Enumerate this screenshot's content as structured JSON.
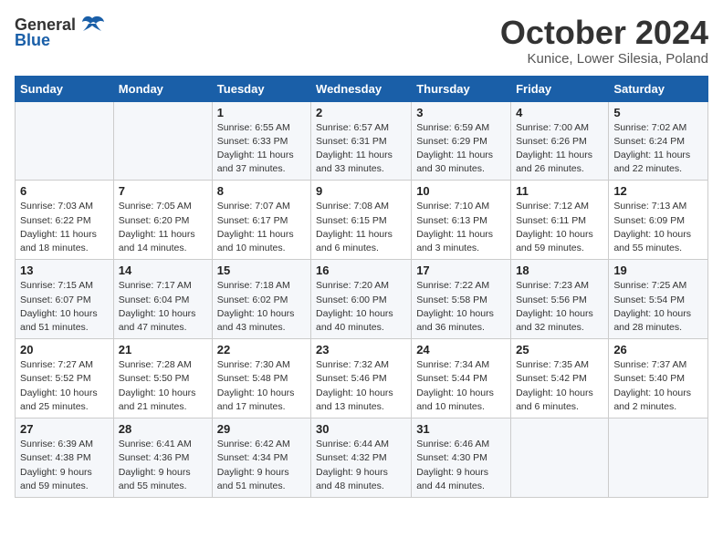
{
  "header": {
    "logo_general": "General",
    "logo_blue": "Blue",
    "month": "October 2024",
    "location": "Kunice, Lower Silesia, Poland"
  },
  "weekdays": [
    "Sunday",
    "Monday",
    "Tuesday",
    "Wednesday",
    "Thursday",
    "Friday",
    "Saturday"
  ],
  "weeks": [
    [
      {
        "day": "",
        "info": ""
      },
      {
        "day": "",
        "info": ""
      },
      {
        "day": "1",
        "info": "Sunrise: 6:55 AM\nSunset: 6:33 PM\nDaylight: 11 hours and 37 minutes."
      },
      {
        "day": "2",
        "info": "Sunrise: 6:57 AM\nSunset: 6:31 PM\nDaylight: 11 hours and 33 minutes."
      },
      {
        "day": "3",
        "info": "Sunrise: 6:59 AM\nSunset: 6:29 PM\nDaylight: 11 hours and 30 minutes."
      },
      {
        "day": "4",
        "info": "Sunrise: 7:00 AM\nSunset: 6:26 PM\nDaylight: 11 hours and 26 minutes."
      },
      {
        "day": "5",
        "info": "Sunrise: 7:02 AM\nSunset: 6:24 PM\nDaylight: 11 hours and 22 minutes."
      }
    ],
    [
      {
        "day": "6",
        "info": "Sunrise: 7:03 AM\nSunset: 6:22 PM\nDaylight: 11 hours and 18 minutes."
      },
      {
        "day": "7",
        "info": "Sunrise: 7:05 AM\nSunset: 6:20 PM\nDaylight: 11 hours and 14 minutes."
      },
      {
        "day": "8",
        "info": "Sunrise: 7:07 AM\nSunset: 6:17 PM\nDaylight: 11 hours and 10 minutes."
      },
      {
        "day": "9",
        "info": "Sunrise: 7:08 AM\nSunset: 6:15 PM\nDaylight: 11 hours and 6 minutes."
      },
      {
        "day": "10",
        "info": "Sunrise: 7:10 AM\nSunset: 6:13 PM\nDaylight: 11 hours and 3 minutes."
      },
      {
        "day": "11",
        "info": "Sunrise: 7:12 AM\nSunset: 6:11 PM\nDaylight: 10 hours and 59 minutes."
      },
      {
        "day": "12",
        "info": "Sunrise: 7:13 AM\nSunset: 6:09 PM\nDaylight: 10 hours and 55 minutes."
      }
    ],
    [
      {
        "day": "13",
        "info": "Sunrise: 7:15 AM\nSunset: 6:07 PM\nDaylight: 10 hours and 51 minutes."
      },
      {
        "day": "14",
        "info": "Sunrise: 7:17 AM\nSunset: 6:04 PM\nDaylight: 10 hours and 47 minutes."
      },
      {
        "day": "15",
        "info": "Sunrise: 7:18 AM\nSunset: 6:02 PM\nDaylight: 10 hours and 43 minutes."
      },
      {
        "day": "16",
        "info": "Sunrise: 7:20 AM\nSunset: 6:00 PM\nDaylight: 10 hours and 40 minutes."
      },
      {
        "day": "17",
        "info": "Sunrise: 7:22 AM\nSunset: 5:58 PM\nDaylight: 10 hours and 36 minutes."
      },
      {
        "day": "18",
        "info": "Sunrise: 7:23 AM\nSunset: 5:56 PM\nDaylight: 10 hours and 32 minutes."
      },
      {
        "day": "19",
        "info": "Sunrise: 7:25 AM\nSunset: 5:54 PM\nDaylight: 10 hours and 28 minutes."
      }
    ],
    [
      {
        "day": "20",
        "info": "Sunrise: 7:27 AM\nSunset: 5:52 PM\nDaylight: 10 hours and 25 minutes."
      },
      {
        "day": "21",
        "info": "Sunrise: 7:28 AM\nSunset: 5:50 PM\nDaylight: 10 hours and 21 minutes."
      },
      {
        "day": "22",
        "info": "Sunrise: 7:30 AM\nSunset: 5:48 PM\nDaylight: 10 hours and 17 minutes."
      },
      {
        "day": "23",
        "info": "Sunrise: 7:32 AM\nSunset: 5:46 PM\nDaylight: 10 hours and 13 minutes."
      },
      {
        "day": "24",
        "info": "Sunrise: 7:34 AM\nSunset: 5:44 PM\nDaylight: 10 hours and 10 minutes."
      },
      {
        "day": "25",
        "info": "Sunrise: 7:35 AM\nSunset: 5:42 PM\nDaylight: 10 hours and 6 minutes."
      },
      {
        "day": "26",
        "info": "Sunrise: 7:37 AM\nSunset: 5:40 PM\nDaylight: 10 hours and 2 minutes."
      }
    ],
    [
      {
        "day": "27",
        "info": "Sunrise: 6:39 AM\nSunset: 4:38 PM\nDaylight: 9 hours and 59 minutes."
      },
      {
        "day": "28",
        "info": "Sunrise: 6:41 AM\nSunset: 4:36 PM\nDaylight: 9 hours and 55 minutes."
      },
      {
        "day": "29",
        "info": "Sunrise: 6:42 AM\nSunset: 4:34 PM\nDaylight: 9 hours and 51 minutes."
      },
      {
        "day": "30",
        "info": "Sunrise: 6:44 AM\nSunset: 4:32 PM\nDaylight: 9 hours and 48 minutes."
      },
      {
        "day": "31",
        "info": "Sunrise: 6:46 AM\nSunset: 4:30 PM\nDaylight: 9 hours and 44 minutes."
      },
      {
        "day": "",
        "info": ""
      },
      {
        "day": "",
        "info": ""
      }
    ]
  ]
}
